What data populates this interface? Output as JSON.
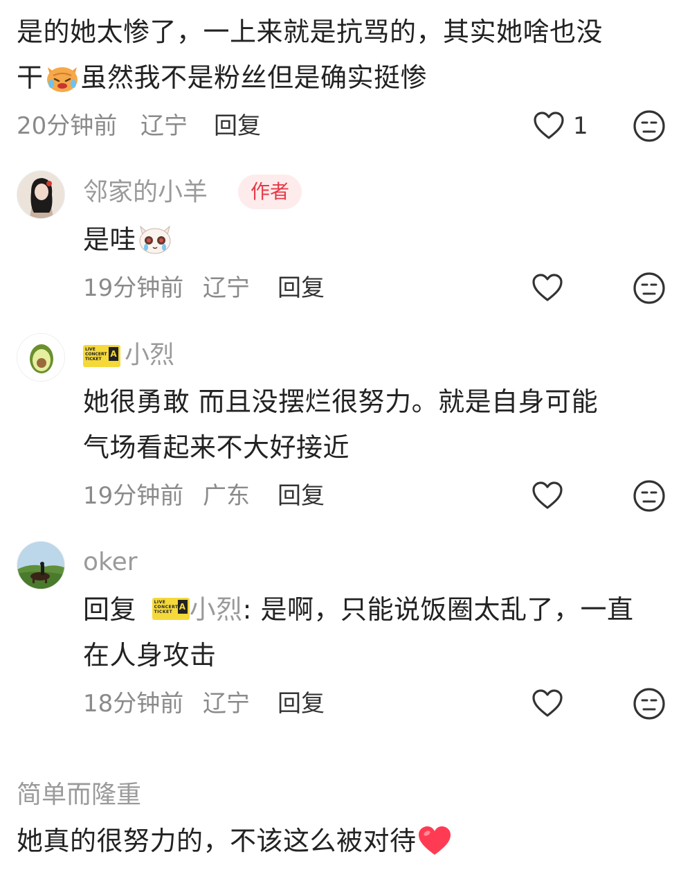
{
  "comments": [
    {
      "text_line1": "是的她太惨了，一上来就是抗骂的，其实她啥也没",
      "text_line2_a": "干",
      "text_line2_b": "虽然我不是粉丝但是确实挺惨",
      "time": "20分钟前",
      "location": "辽宁",
      "reply_label": "回复",
      "likes": "1"
    },
    {
      "username": "邻家的小羊",
      "badge": "作者",
      "text": "是哇",
      "time": "19分钟前",
      "location": "辽宁",
      "reply_label": "回复"
    },
    {
      "username": "小烈",
      "text_line1": "她很勇敢  而且没摆烂很努力。就是自身可能",
      "text_line2": "气场看起来不大好接近",
      "time": "19分钟前",
      "location": "广东",
      "reply_label": "回复"
    },
    {
      "username": "oker",
      "reply_prefix": "回复",
      "reply_to": "小烈",
      "text_line1_rest": ": 是啊，只能说饭圈太乱了，一直",
      "text_line2": "在人身攻击",
      "time": "18分钟前",
      "location": "辽宁",
      "reply_label": "回复"
    },
    {
      "username": "简单而隆重",
      "text": "她真的很努力的，不该这么被对待"
    }
  ],
  "ticket_badge": {
    "lines": [
      "LIVE",
      "CONCERT",
      "TICKET"
    ],
    "zone": "A"
  },
  "colors": {
    "badge_text": "#e6394a",
    "badge_bg": "#fdeceb",
    "meta_text": "#8a8a8a",
    "heart": "#ff4d5e"
  }
}
